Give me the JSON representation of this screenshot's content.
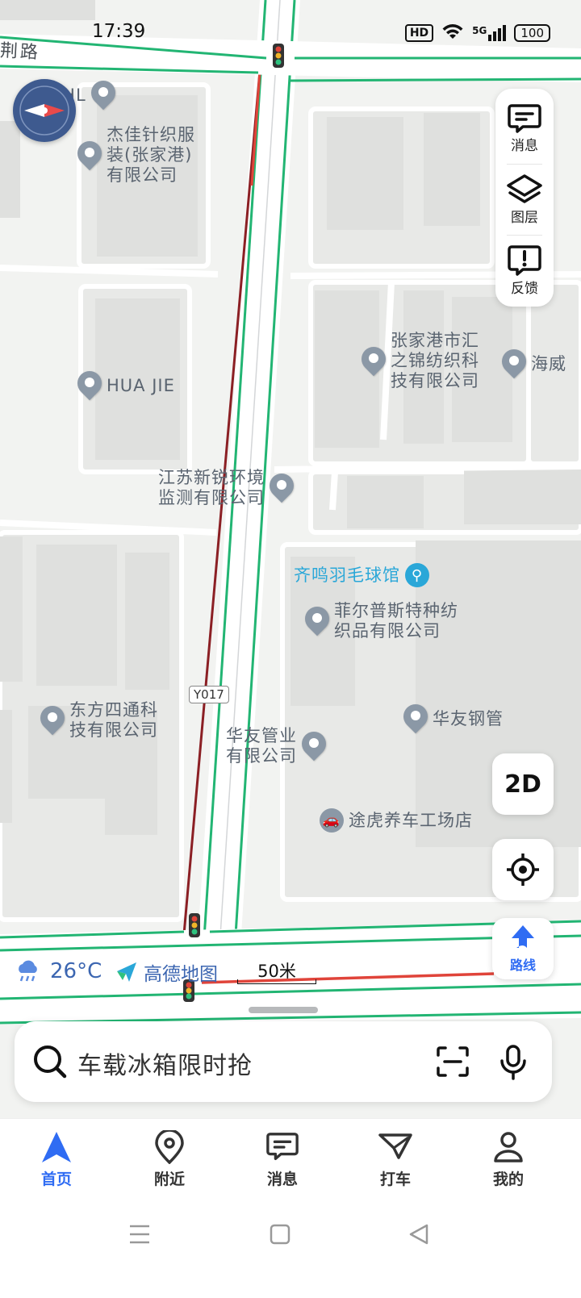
{
  "status_bar": {
    "time": "17:39",
    "hd_label": "HD",
    "signal_label": "5G",
    "battery_level": "100"
  },
  "map": {
    "road_label_top": "荆路",
    "road_badge": "Y017",
    "pois": [
      {
        "name": "DHL"
      },
      {
        "name": "杰佳针织服\n装(张家港)\n有限公司"
      },
      {
        "name": "HUA JIE"
      },
      {
        "name": "张家港市汇\n之锦纺织科\n技有限公司"
      },
      {
        "name": "海威"
      },
      {
        "name": "江苏新锐环境\n监测有限公司"
      },
      {
        "name": "齐鸣羽毛球馆"
      },
      {
        "name": "菲尔普斯特种纺\n织品有限公司"
      },
      {
        "name": "东方四通科\n技有限公司"
      },
      {
        "name": "华友钢管"
      },
      {
        "name": "华友管业\n有限公司"
      },
      {
        "name": "途虎养车工场店"
      }
    ],
    "colors": {
      "road_border": "#22b573",
      "traffic_red": "#e0443a",
      "poi_sport": "#2aa7d8"
    }
  },
  "right_panel": {
    "items": [
      {
        "label": "消息",
        "icon": "message-icon"
      },
      {
        "label": "图层",
        "icon": "layers-icon"
      },
      {
        "label": "反馈",
        "icon": "feedback-icon"
      }
    ]
  },
  "controls": {
    "view_mode": "2D",
    "route_label": "路线"
  },
  "info_bar": {
    "temperature": "26°C",
    "brand": "高德地图",
    "scale": "50米"
  },
  "search": {
    "placeholder": "车载冰箱限时抢"
  },
  "bottom_nav": {
    "items": [
      {
        "label": "首页",
        "icon": "home-nav-icon",
        "active": true
      },
      {
        "label": "附近",
        "icon": "location-pin-icon",
        "active": false
      },
      {
        "label": "消息",
        "icon": "message-icon",
        "active": false
      },
      {
        "label": "打车",
        "icon": "taxi-icon",
        "active": false
      },
      {
        "label": "我的",
        "icon": "user-icon",
        "active": false
      }
    ],
    "accent_color": "#2f6cf3"
  }
}
